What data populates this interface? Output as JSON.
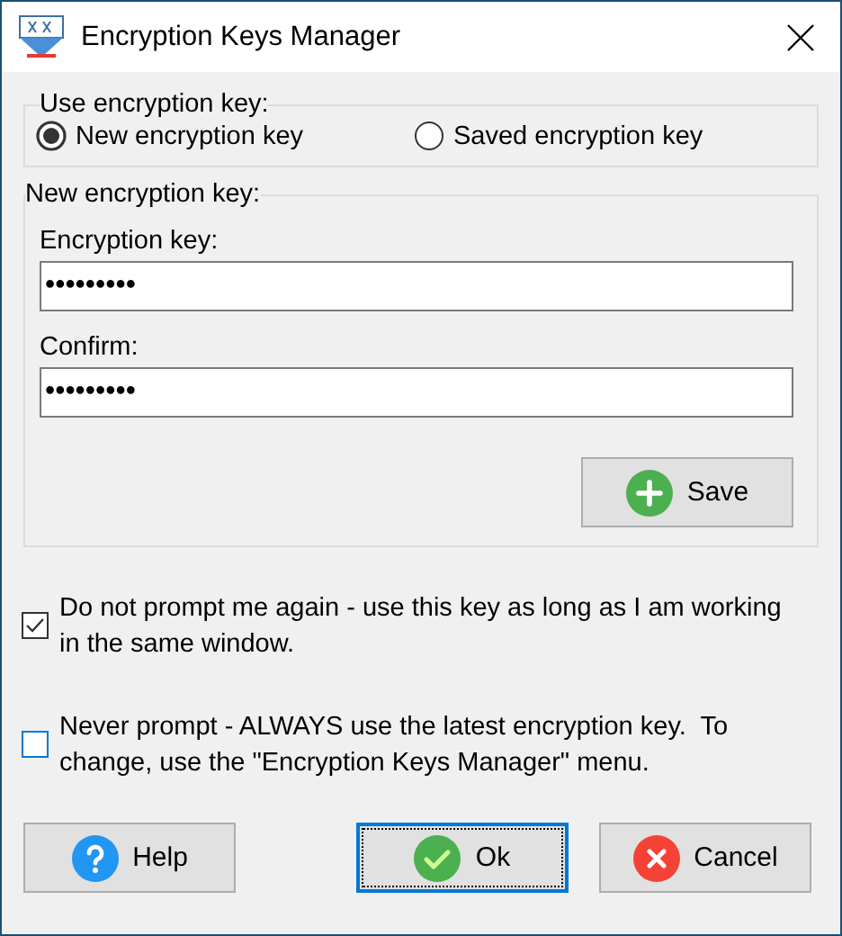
{
  "window": {
    "title": "Encryption Keys Manager"
  },
  "key_source": {
    "label": "Use encryption key:",
    "options": [
      {
        "label": "New encryption key",
        "selected": true
      },
      {
        "label": "Saved encryption key",
        "selected": false
      }
    ]
  },
  "new_key": {
    "label": "New encryption key:",
    "fields": [
      {
        "label": "Encryption key:",
        "value": "•••••••••"
      },
      {
        "label": "Confirm:",
        "value": "•••••••••"
      }
    ],
    "save_button": "Save"
  },
  "options": [
    {
      "label": "Do not prompt me again - use this key as long as I am working in the same window.",
      "checked": true
    },
    {
      "label": "Never prompt - ALWAYS use the latest encryption key.  To change, use the \"Encryption Keys Manager\" menu.",
      "checked": false
    }
  ],
  "buttons": [
    {
      "kind": "help",
      "label": "Help",
      "default": false
    },
    {
      "kind": "ok",
      "label": "Ok",
      "default": true
    },
    {
      "kind": "cancel",
      "label": "Cancel",
      "default": false
    }
  ]
}
